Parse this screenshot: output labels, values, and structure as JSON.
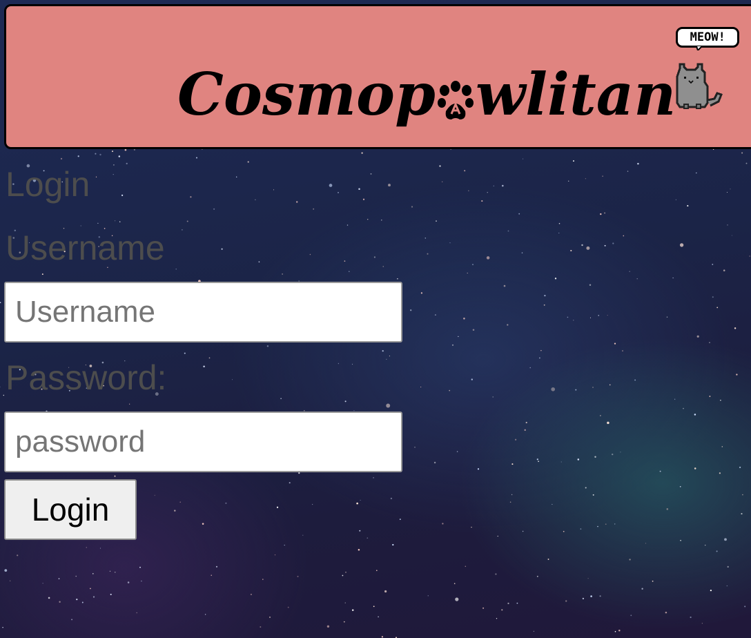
{
  "header": {
    "brand_part1": "Cosmop",
    "brand_part2": "wlitan",
    "bubble_text": "MEOW!"
  },
  "form": {
    "title": "Login",
    "username_label": "Username",
    "username_placeholder": "Username",
    "username_value": "",
    "password_label": "Password:",
    "password_placeholder": "password",
    "password_value": "",
    "submit_label": "Login"
  },
  "icons": {
    "brand_paw": "paw-print-icon",
    "mascot": "pixel-cat-icon",
    "speech": "speech-bubble-icon"
  },
  "colors": {
    "header_bg": "#e08480",
    "label_text": "#4d4d4d"
  }
}
